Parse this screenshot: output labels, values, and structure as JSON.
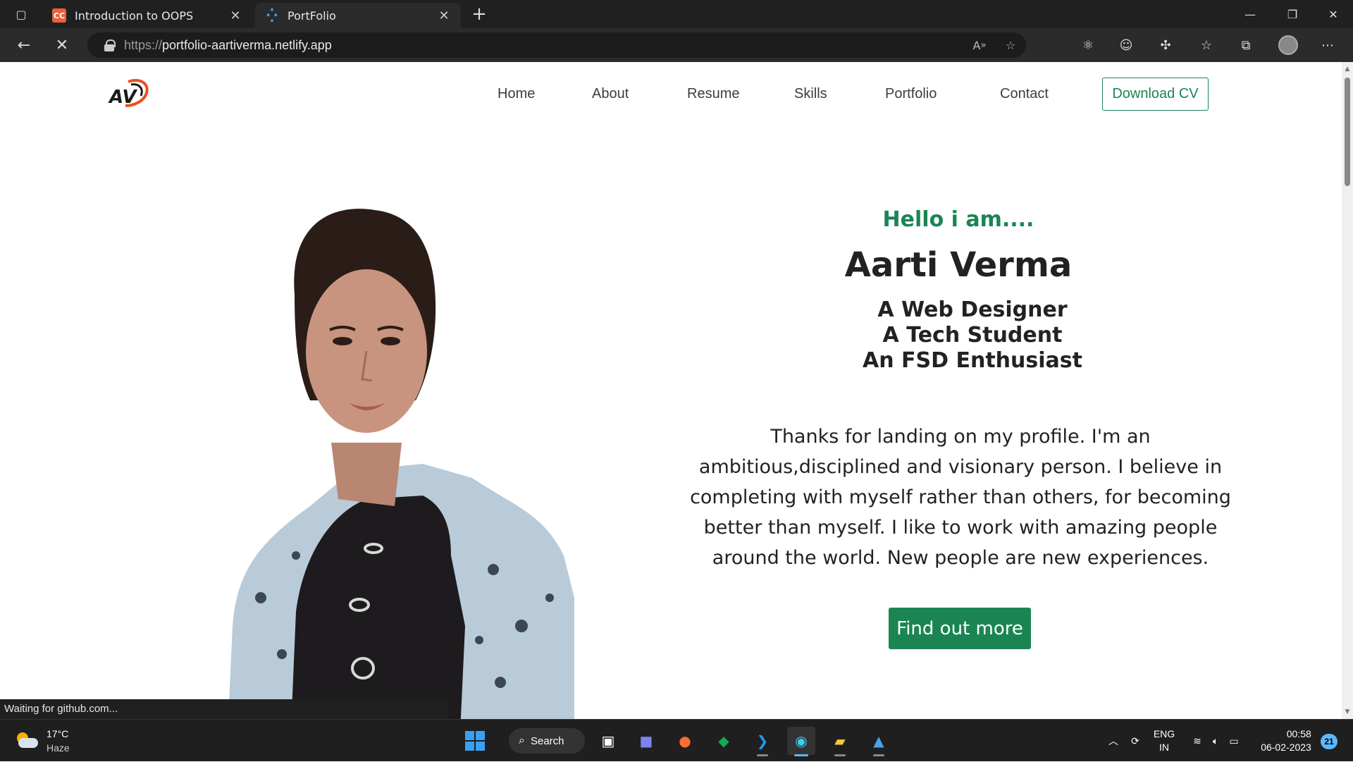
{
  "browser": {
    "tabs": [
      {
        "title": "Introduction to OOPS",
        "favicon": "coding-ninjas-icon",
        "active": false
      },
      {
        "title": "PortFolio",
        "favicon": "loading-spinner-icon",
        "active": true
      }
    ],
    "url": {
      "protocol": "https://",
      "host": "portfolio-aartiverma.netlify.app"
    },
    "status_text": "Waiting for github.com..."
  },
  "site": {
    "logo_text": "AV",
    "nav": [
      "Home",
      "About",
      "Resume",
      "Skills",
      "Portfolio",
      "Contact"
    ],
    "cta": "Download CV",
    "hero": {
      "greeting": "Hello i am....",
      "name": "Aarti Verma",
      "roles": [
        "A Web Designer",
        "A Tech Student",
        "An FSD Enthusiast"
      ],
      "bio": "Thanks for landing on my profile. I'm an ambitious,disciplined and visionary person. I believe in completing with myself rather than others, for becoming better than myself. I like to work with amazing people around the world. New people are new experiences.",
      "button": "Find out more"
    },
    "accent_color": "#1a8553"
  },
  "taskbar": {
    "weather": {
      "temp": "17°C",
      "condition": "Haze"
    },
    "search_label": "Search",
    "language": {
      "line1": "ENG",
      "line2": "IN"
    },
    "time": "00:58",
    "date": "06-02-2023",
    "notification_count": "21"
  }
}
